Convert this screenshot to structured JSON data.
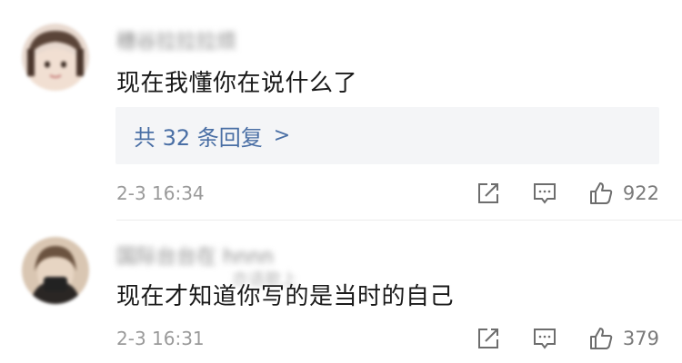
{
  "comments": [
    {
      "username": "穗谷拉拉拉烦",
      "content": "现在我懂你在说什么了",
      "reply_summary": "共 32 条回复",
      "reply_chevron": ">",
      "timestamp": "2-3 16:34",
      "like_count": "922"
    },
    {
      "username": "国际台台在 hnnn",
      "faint_overlay": "亦语歌上",
      "content": "现在才知道你写的是当时的自己",
      "timestamp": "2-3 16:31",
      "like_count": "379"
    }
  ],
  "colors": {
    "link_blue": "#4a6fa5",
    "icon_gray": "#6d6d6d",
    "reply_bg": "#f4f5f7"
  },
  "icons": [
    "share-icon",
    "comment-icon",
    "like-icon"
  ]
}
